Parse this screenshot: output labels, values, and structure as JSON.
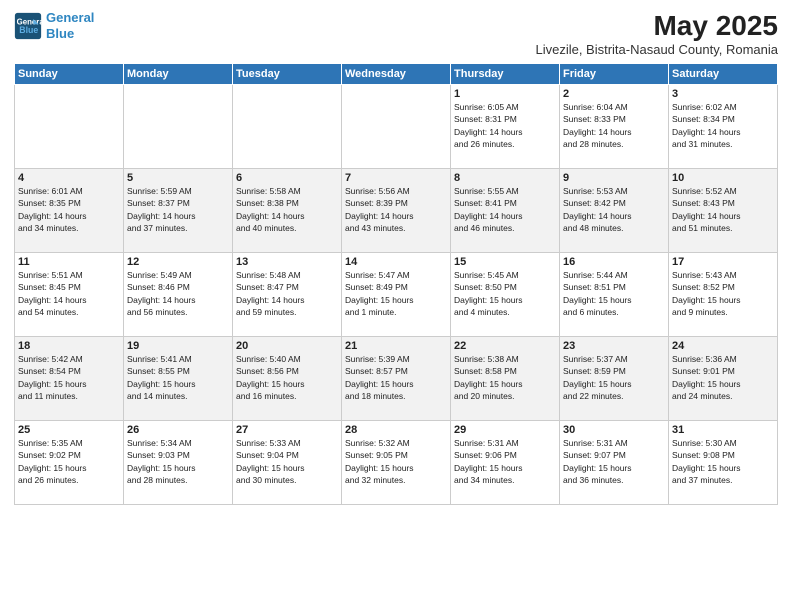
{
  "header": {
    "logo_line1": "General",
    "logo_line2": "Blue",
    "title": "May 2025",
    "subtitle": "Livezile, Bistrita-Nasaud County, Romania"
  },
  "weekdays": [
    "Sunday",
    "Monday",
    "Tuesday",
    "Wednesday",
    "Thursday",
    "Friday",
    "Saturday"
  ],
  "weeks": [
    [
      {
        "num": "",
        "info": ""
      },
      {
        "num": "",
        "info": ""
      },
      {
        "num": "",
        "info": ""
      },
      {
        "num": "",
        "info": ""
      },
      {
        "num": "1",
        "info": "Sunrise: 6:05 AM\nSunset: 8:31 PM\nDaylight: 14 hours\nand 26 minutes."
      },
      {
        "num": "2",
        "info": "Sunrise: 6:04 AM\nSunset: 8:33 PM\nDaylight: 14 hours\nand 28 minutes."
      },
      {
        "num": "3",
        "info": "Sunrise: 6:02 AM\nSunset: 8:34 PM\nDaylight: 14 hours\nand 31 minutes."
      }
    ],
    [
      {
        "num": "4",
        "info": "Sunrise: 6:01 AM\nSunset: 8:35 PM\nDaylight: 14 hours\nand 34 minutes."
      },
      {
        "num": "5",
        "info": "Sunrise: 5:59 AM\nSunset: 8:37 PM\nDaylight: 14 hours\nand 37 minutes."
      },
      {
        "num": "6",
        "info": "Sunrise: 5:58 AM\nSunset: 8:38 PM\nDaylight: 14 hours\nand 40 minutes."
      },
      {
        "num": "7",
        "info": "Sunrise: 5:56 AM\nSunset: 8:39 PM\nDaylight: 14 hours\nand 43 minutes."
      },
      {
        "num": "8",
        "info": "Sunrise: 5:55 AM\nSunset: 8:41 PM\nDaylight: 14 hours\nand 46 minutes."
      },
      {
        "num": "9",
        "info": "Sunrise: 5:53 AM\nSunset: 8:42 PM\nDaylight: 14 hours\nand 48 minutes."
      },
      {
        "num": "10",
        "info": "Sunrise: 5:52 AM\nSunset: 8:43 PM\nDaylight: 14 hours\nand 51 minutes."
      }
    ],
    [
      {
        "num": "11",
        "info": "Sunrise: 5:51 AM\nSunset: 8:45 PM\nDaylight: 14 hours\nand 54 minutes."
      },
      {
        "num": "12",
        "info": "Sunrise: 5:49 AM\nSunset: 8:46 PM\nDaylight: 14 hours\nand 56 minutes."
      },
      {
        "num": "13",
        "info": "Sunrise: 5:48 AM\nSunset: 8:47 PM\nDaylight: 14 hours\nand 59 minutes."
      },
      {
        "num": "14",
        "info": "Sunrise: 5:47 AM\nSunset: 8:49 PM\nDaylight: 15 hours\nand 1 minute."
      },
      {
        "num": "15",
        "info": "Sunrise: 5:45 AM\nSunset: 8:50 PM\nDaylight: 15 hours\nand 4 minutes."
      },
      {
        "num": "16",
        "info": "Sunrise: 5:44 AM\nSunset: 8:51 PM\nDaylight: 15 hours\nand 6 minutes."
      },
      {
        "num": "17",
        "info": "Sunrise: 5:43 AM\nSunset: 8:52 PM\nDaylight: 15 hours\nand 9 minutes."
      }
    ],
    [
      {
        "num": "18",
        "info": "Sunrise: 5:42 AM\nSunset: 8:54 PM\nDaylight: 15 hours\nand 11 minutes."
      },
      {
        "num": "19",
        "info": "Sunrise: 5:41 AM\nSunset: 8:55 PM\nDaylight: 15 hours\nand 14 minutes."
      },
      {
        "num": "20",
        "info": "Sunrise: 5:40 AM\nSunset: 8:56 PM\nDaylight: 15 hours\nand 16 minutes."
      },
      {
        "num": "21",
        "info": "Sunrise: 5:39 AM\nSunset: 8:57 PM\nDaylight: 15 hours\nand 18 minutes."
      },
      {
        "num": "22",
        "info": "Sunrise: 5:38 AM\nSunset: 8:58 PM\nDaylight: 15 hours\nand 20 minutes."
      },
      {
        "num": "23",
        "info": "Sunrise: 5:37 AM\nSunset: 8:59 PM\nDaylight: 15 hours\nand 22 minutes."
      },
      {
        "num": "24",
        "info": "Sunrise: 5:36 AM\nSunset: 9:01 PM\nDaylight: 15 hours\nand 24 minutes."
      }
    ],
    [
      {
        "num": "25",
        "info": "Sunrise: 5:35 AM\nSunset: 9:02 PM\nDaylight: 15 hours\nand 26 minutes."
      },
      {
        "num": "26",
        "info": "Sunrise: 5:34 AM\nSunset: 9:03 PM\nDaylight: 15 hours\nand 28 minutes."
      },
      {
        "num": "27",
        "info": "Sunrise: 5:33 AM\nSunset: 9:04 PM\nDaylight: 15 hours\nand 30 minutes."
      },
      {
        "num": "28",
        "info": "Sunrise: 5:32 AM\nSunset: 9:05 PM\nDaylight: 15 hours\nand 32 minutes."
      },
      {
        "num": "29",
        "info": "Sunrise: 5:31 AM\nSunset: 9:06 PM\nDaylight: 15 hours\nand 34 minutes."
      },
      {
        "num": "30",
        "info": "Sunrise: 5:31 AM\nSunset: 9:07 PM\nDaylight: 15 hours\nand 36 minutes."
      },
      {
        "num": "31",
        "info": "Sunrise: 5:30 AM\nSunset: 9:08 PM\nDaylight: 15 hours\nand 37 minutes."
      }
    ]
  ]
}
